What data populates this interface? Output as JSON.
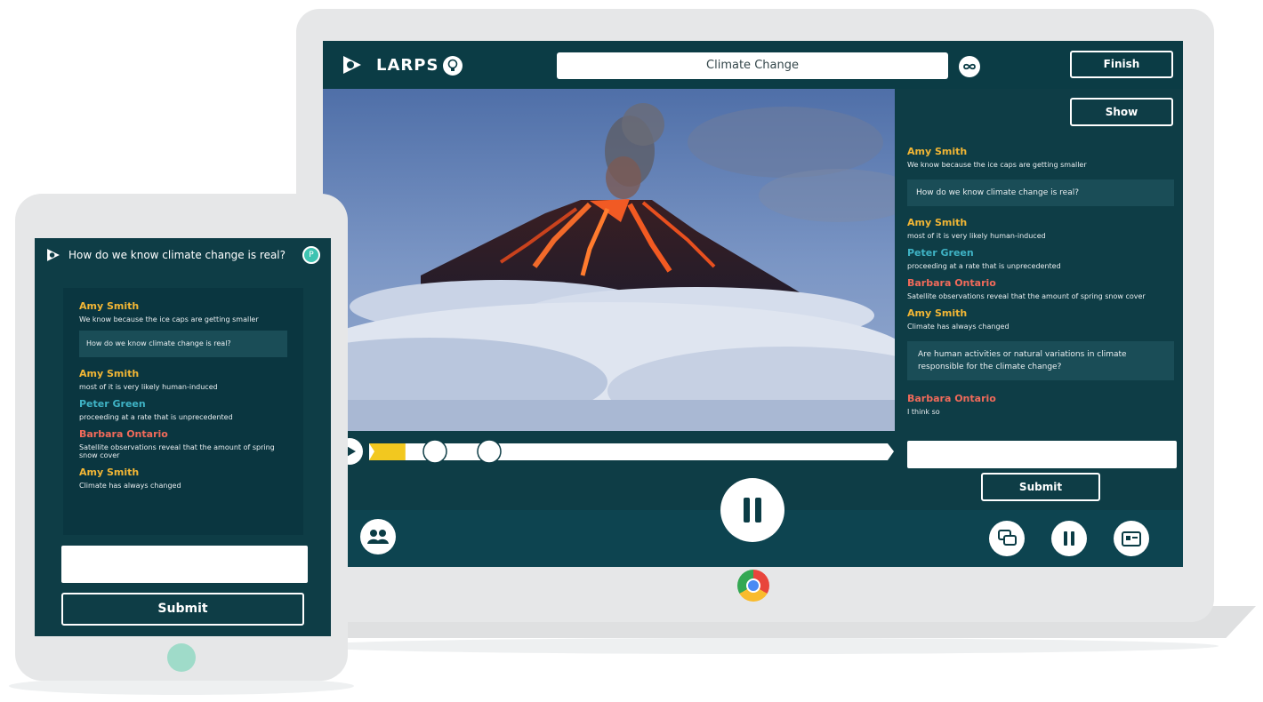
{
  "laptop": {
    "brand": "LARPS",
    "topic": "Climate Change",
    "finish_label": "Finish",
    "show_label": "Show",
    "submit_label": "Submit",
    "answer_placeholder": "",
    "progress": 0.07,
    "messages": [
      {
        "name": "Amy Smith",
        "text": "We know because the ice caps are getting smaller"
      },
      {
        "question": "How do we know climate change is real?"
      },
      {
        "name": "Amy Smith",
        "text": "most of it is very likely human-induced"
      },
      {
        "name": "Peter Green",
        "text": "proceeding at a rate that is unprecedented"
      },
      {
        "name": "Barbara Ontario",
        "text": "Satellite observations reveal that the amount of spring snow cover"
      },
      {
        "name": "Amy Smith",
        "text": "Climate has always changed"
      },
      {
        "question": "Are human activities or natural variations in climate responsible for the climate change?"
      },
      {
        "name": "Barbara Ontario",
        "text": "I think so"
      }
    ]
  },
  "tablet": {
    "title": "How do we know climate change is real?",
    "avatar_initial": "P",
    "submit_label": "Submit",
    "messages": [
      {
        "name": "Amy Smith",
        "text": "We know because the ice caps are getting smaller"
      },
      {
        "question": "How do we know climate change is real?"
      },
      {
        "name": "Amy Smith",
        "text": "most of it is very likely human-induced"
      },
      {
        "name": "Peter Green",
        "text": "proceeding at a rate that is unprecedented"
      },
      {
        "name": "Barbara Ontario",
        "text": "Satellite observations reveal that the amount of spring snow cover"
      },
      {
        "name": "Amy Smith",
        "text": "Climate has always changed"
      }
    ]
  },
  "colors": {
    "app_bg": "#0e3d46",
    "amy": "#f2b635",
    "peter": "#3fb3c5",
    "barbara": "#f06a5a",
    "progress_fill": "#f2c81f"
  },
  "icons": [
    "logo-icon",
    "lightbulb-icon",
    "infinity-icon",
    "play-icon",
    "pause-icon",
    "group-icon",
    "chat-icon",
    "pause-small-icon",
    "slideshow-icon",
    "chrome-icon"
  ]
}
